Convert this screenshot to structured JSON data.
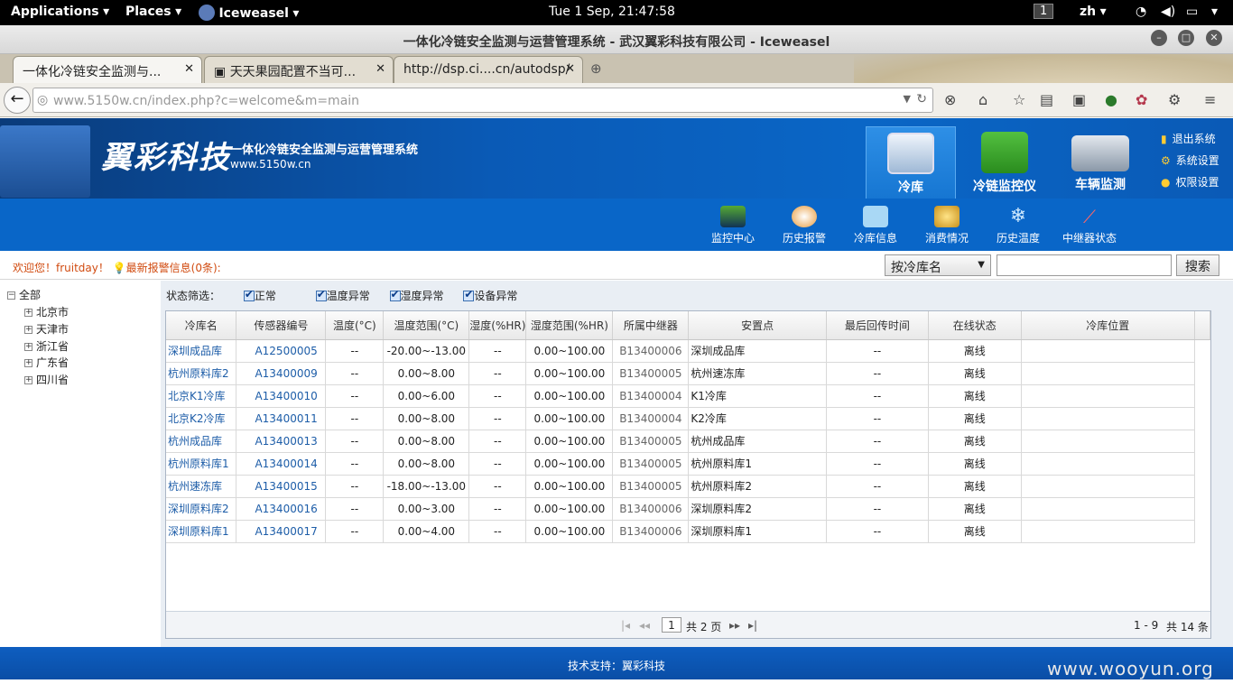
{
  "gnome": {
    "applications": "Applications",
    "places": "Places",
    "app": "Iceweasel",
    "clock": "Tue  1 Sep, 21:47:58",
    "workspace": "1",
    "lang": "zh"
  },
  "window": {
    "title": "一体化冷链安全监测与运营管理系统 - 武汉翼彩科技有限公司 - Iceweasel"
  },
  "tabs": [
    {
      "label": "一体化冷链安全监测与..."
    },
    {
      "label": "天天果园配置不当可..."
    },
    {
      "label": "http://dsp.ci....cn/autodsp/"
    }
  ],
  "url": "www.5150w.cn/index.php?c=welcome&m=main",
  "header": {
    "logo": "翼彩科技",
    "title": "一体化冷链安全监测与运营管理系统",
    "site": "www.5150w.cn"
  },
  "mainnav": [
    "冷库",
    "冷链监控仪",
    "车辆监测"
  ],
  "toplinks": [
    "退出系统",
    "系统设置",
    "权限设置"
  ],
  "subnav": [
    "监控中心",
    "历史报警",
    "冷库信息",
    "消费情况",
    "历史温度",
    "中继器状态"
  ],
  "welcome": {
    "greet": "欢迎您！fruitday！",
    "alarm": "最新报警信息(0条):"
  },
  "search": {
    "select": "按冷库名",
    "button": "搜索"
  },
  "tree": {
    "root": "全部",
    "items": [
      "北京市",
      "天津市",
      "浙江省",
      "广东省",
      "四川省"
    ]
  },
  "filter": {
    "label": "状态筛选：",
    "options": [
      "正常",
      "温度异常",
      "湿度异常",
      "设备异常"
    ]
  },
  "table": {
    "columns": [
      "冷库名",
      "传感器编号",
      "温度(°C)",
      "温度范围(°C)",
      "湿度(%HR)",
      "湿度范围(%HR)",
      "所属中继器",
      "安置点",
      "最后回传时间",
      "在线状态",
      "冷库位置"
    ],
    "rows": [
      [
        "深圳成品库",
        "A12500005",
        "--",
        "-20.00~-13.00",
        "--",
        "0.00~100.00",
        "B13400006",
        "深圳成品库",
        "--",
        "离线",
        ""
      ],
      [
        "杭州原料库2",
        "A13400009",
        "--",
        "0.00~8.00",
        "--",
        "0.00~100.00",
        "B13400005",
        "杭州速冻库",
        "--",
        "离线",
        ""
      ],
      [
        "北京K1冷库",
        "A13400010",
        "--",
        "0.00~6.00",
        "--",
        "0.00~100.00",
        "B13400004",
        "K1冷库",
        "--",
        "离线",
        ""
      ],
      [
        "北京K2冷库",
        "A13400011",
        "--",
        "0.00~8.00",
        "--",
        "0.00~100.00",
        "B13400004",
        "K2冷库",
        "--",
        "离线",
        ""
      ],
      [
        "杭州成品库",
        "A13400013",
        "--",
        "0.00~8.00",
        "--",
        "0.00~100.00",
        "B13400005",
        "杭州成品库",
        "--",
        "离线",
        ""
      ],
      [
        "杭州原料库1",
        "A13400014",
        "--",
        "0.00~8.00",
        "--",
        "0.00~100.00",
        "B13400005",
        "杭州原料库1",
        "--",
        "离线",
        ""
      ],
      [
        "杭州速冻库",
        "A13400015",
        "--",
        "-18.00~-13.00",
        "--",
        "0.00~100.00",
        "B13400005",
        "杭州原料库2",
        "--",
        "离线",
        ""
      ],
      [
        "深圳原料库2",
        "A13400016",
        "--",
        "0.00~3.00",
        "--",
        "0.00~100.00",
        "B13400006",
        "深圳原料库2",
        "--",
        "离线",
        ""
      ],
      [
        "深圳原料库1",
        "A13400017",
        "--",
        "0.00~4.00",
        "--",
        "0.00~100.00",
        "B13400006",
        "深圳原料库1",
        "--",
        "离线",
        ""
      ]
    ]
  },
  "pager": {
    "page": "1",
    "total": "共 2 页",
    "range": "1 - 9",
    "count": "共 14 条"
  },
  "footer": "技术支持：翼彩科技",
  "watermark": "www.wooyun.org",
  "colors": {
    "banner": "#0a5ab6",
    "subnav": "#0966c8",
    "link": "#1d5da8",
    "alert": "#d14b10"
  }
}
